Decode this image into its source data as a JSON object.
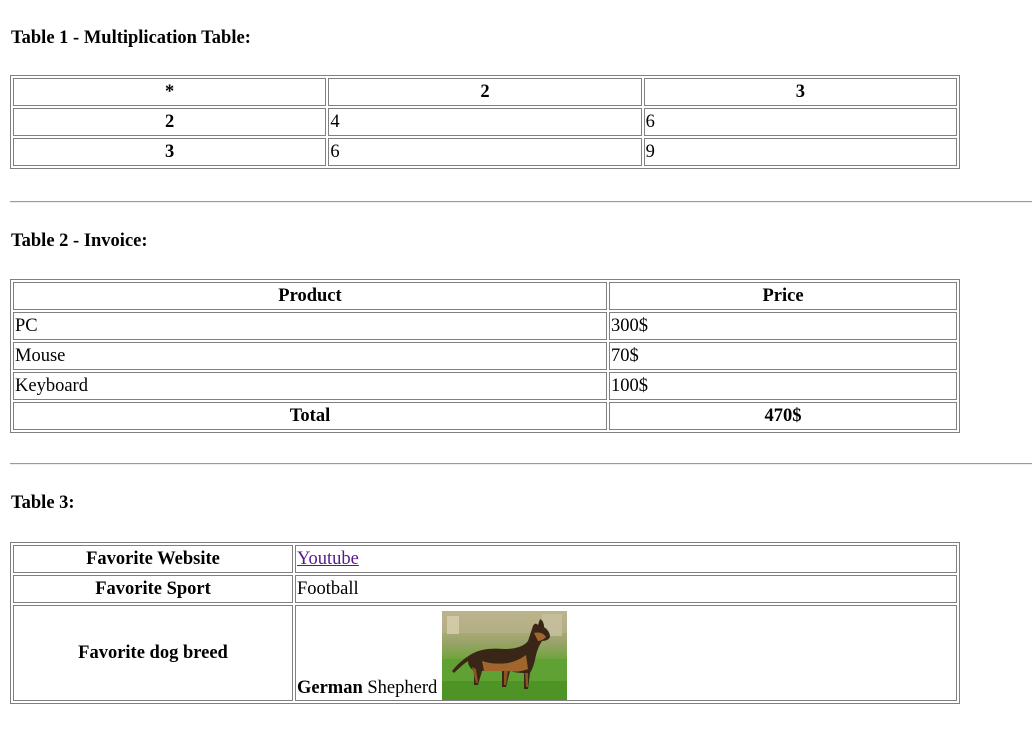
{
  "table1": {
    "heading": "Table 1 - Multiplication Table:",
    "header": [
      "*",
      "2",
      "3"
    ],
    "rows": [
      {
        "label": "2",
        "cells": [
          "4",
          "6"
        ]
      },
      {
        "label": "3",
        "cells": [
          "6",
          "9"
        ]
      }
    ]
  },
  "table2": {
    "heading": "Table 2 - Invoice:",
    "header": [
      "Product",
      "Price"
    ],
    "rows": [
      {
        "product": "PC",
        "price": "300$"
      },
      {
        "product": "Mouse",
        "price": "70$"
      },
      {
        "product": "Keyboard",
        "price": "100$"
      }
    ],
    "total_label": "Total",
    "total_value": "470$"
  },
  "table3": {
    "heading": "Table 3:",
    "website_label": "Favorite Website",
    "website_value": "Youtube",
    "sport_label": "Favorite Sport",
    "sport_value": "Football",
    "dog_label": "Favorite dog breed",
    "dog_bold": "German",
    "dog_rest": " Shepherd",
    "dog_image": "german-shepherd-photo"
  }
}
